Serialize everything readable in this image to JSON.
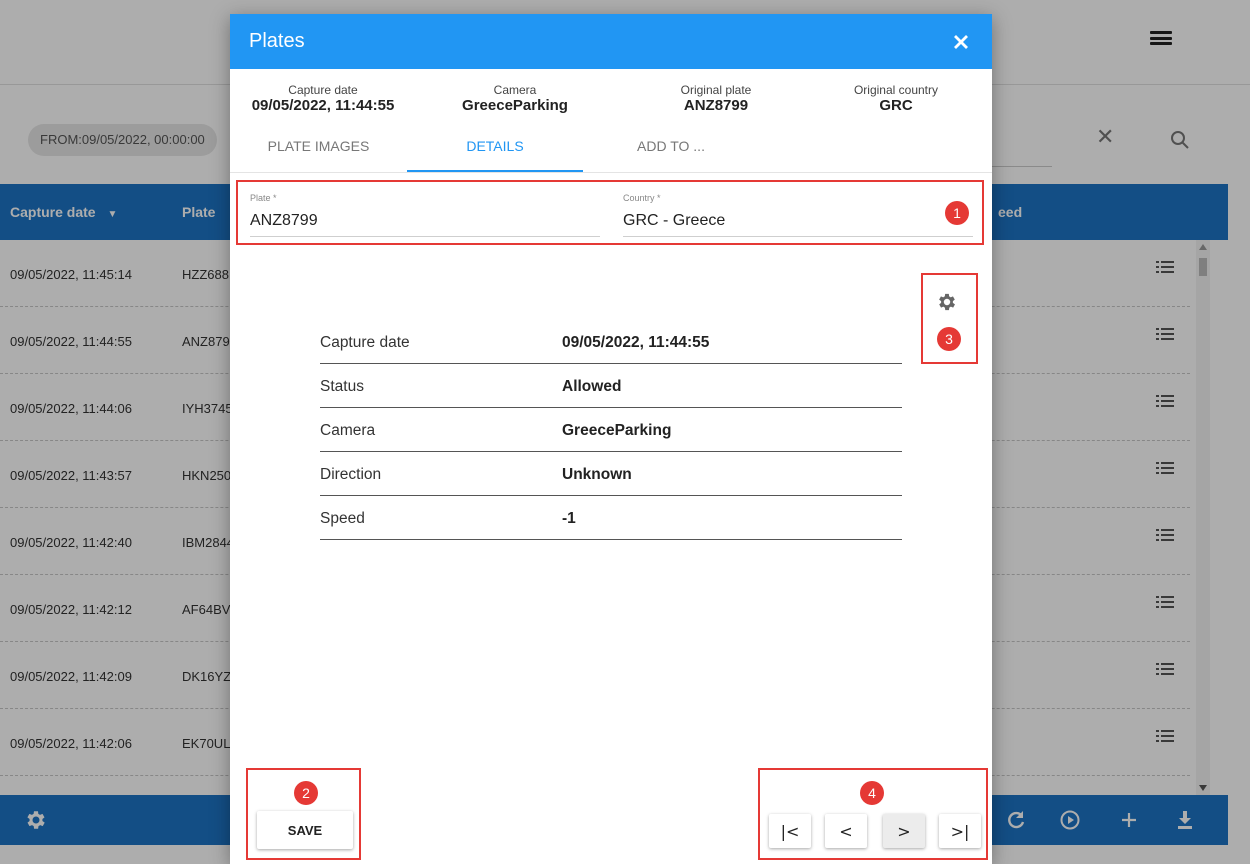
{
  "background": {
    "filter_chip": "FROM:09/05/2022, 00:00:00",
    "grid_headers": {
      "capture_date": "Capture date",
      "plate": "Plate",
      "speed": "eed"
    },
    "rows": [
      {
        "date": "09/05/2022, 11:45:14",
        "plate": "HZZ688"
      },
      {
        "date": "09/05/2022, 11:44:55",
        "plate": "ANZ879"
      },
      {
        "date": "09/05/2022, 11:44:06",
        "plate": "IYH3745"
      },
      {
        "date": "09/05/2022, 11:43:57",
        "plate": "HKN250"
      },
      {
        "date": "09/05/2022, 11:42:40",
        "plate": "IBM2844"
      },
      {
        "date": "09/05/2022, 11:42:12",
        "plate": "AF64BV"
      },
      {
        "date": "09/05/2022, 11:42:09",
        "plate": "DK16YZ"
      },
      {
        "date": "09/05/2022, 11:42:06",
        "plate": "EK70UL"
      }
    ],
    "footer_icons": [
      "gear-icon",
      "refresh-icon",
      "play-circle-icon",
      "plus-icon",
      "download-icon"
    ]
  },
  "dialog": {
    "title": "Plates",
    "info": {
      "capture_date_label": "Capture date",
      "capture_date_value": "09/05/2022, 11:44:55",
      "camera_label": "Camera",
      "camera_value": "GreeceParking",
      "original_plate_label": "Original plate",
      "original_plate_value": "ANZ8799",
      "original_country_label": "Original country",
      "original_country_value": "GRC"
    },
    "tabs": [
      {
        "label": "PLATE IMAGES",
        "active": false
      },
      {
        "label": "DETAILS",
        "active": true
      },
      {
        "label": "ADD TO ...",
        "active": false
      }
    ],
    "fields": {
      "plate_label": "Plate *",
      "plate_value": "ANZ8799",
      "country_label": "Country *",
      "country_value": "GRC - Greece"
    },
    "details": [
      {
        "key": "Capture date",
        "value": "09/05/2022, 11:44:55"
      },
      {
        "key": "Status",
        "value": "Allowed"
      },
      {
        "key": "Camera",
        "value": "GreeceParking"
      },
      {
        "key": "Direction",
        "value": "Unknown"
      },
      {
        "key": "Speed",
        "value": "-1"
      }
    ],
    "save_label": "SAVE",
    "nav": {
      "first": "|<",
      "prev": "<",
      "next": ">",
      "last": ">|"
    }
  },
  "callouts": [
    "1",
    "2",
    "3",
    "4"
  ],
  "colors": {
    "primary": "#2196f3",
    "grid_blue": "#1d74c4",
    "callout_red": "#e53935"
  }
}
